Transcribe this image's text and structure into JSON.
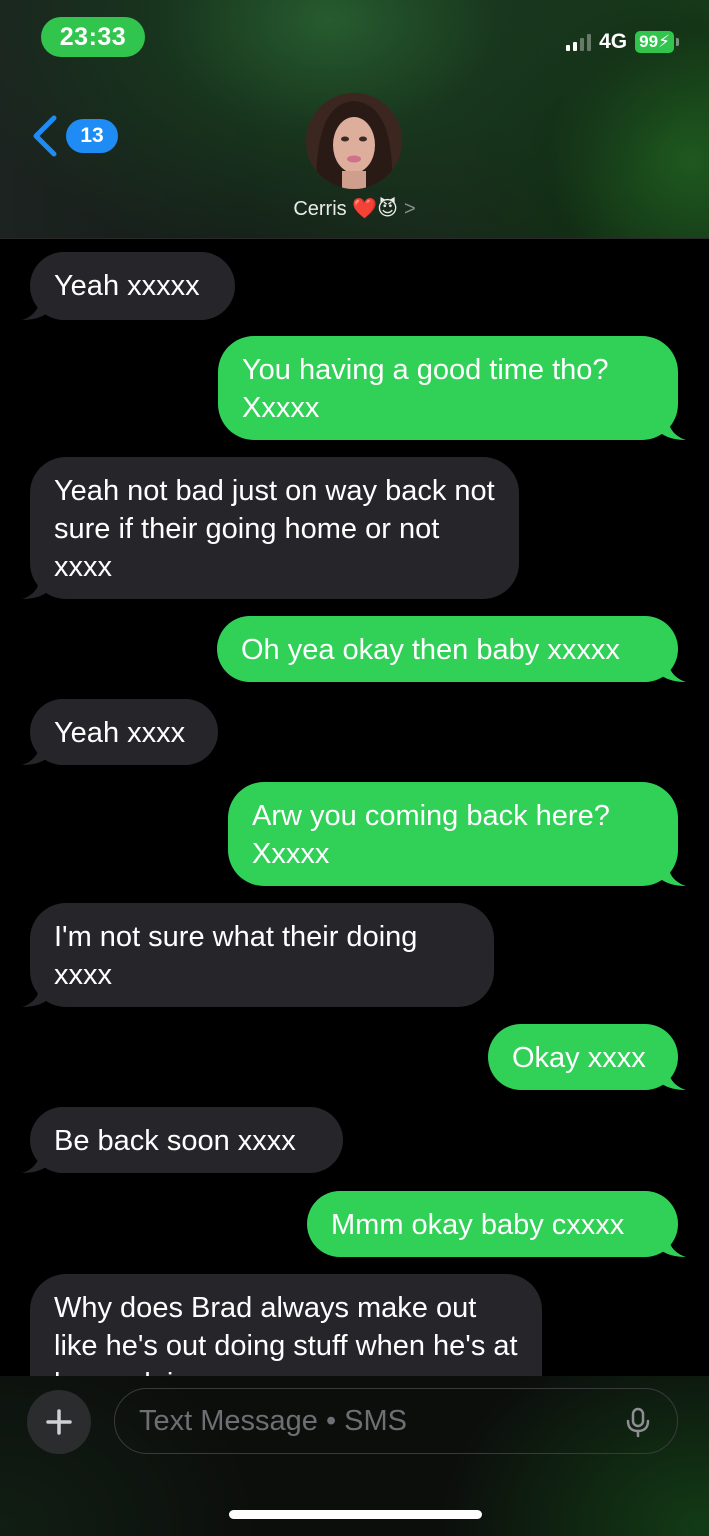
{
  "status_bar": {
    "time": "23:33",
    "network": "4G",
    "battery": "99"
  },
  "header": {
    "back_count": "13",
    "contact_name": "Cerris ❤️😈",
    "contact_chevron": ">"
  },
  "messages": [
    {
      "direction": "in",
      "text": "Yeah xxxxx"
    },
    {
      "direction": "out",
      "text": "You having a good time tho? Xxxxx"
    },
    {
      "direction": "in",
      "text": "Yeah not bad just on way back not sure if their going home or not xxxx"
    },
    {
      "direction": "out",
      "text": "Oh yea okay then baby xxxxx"
    },
    {
      "direction": "in",
      "text": "Yeah xxxx"
    },
    {
      "direction": "out",
      "text": "Arw you coming back here? Xxxxx"
    },
    {
      "direction": "in",
      "text": "I'm not sure what their doing xxxx"
    },
    {
      "direction": "out",
      "text": "Okay xxxx"
    },
    {
      "direction": "in",
      "text": "Be back soon xxxx"
    },
    {
      "direction": "out",
      "text": "Mmm okay baby cxxxx"
    },
    {
      "direction": "in",
      "text": "Why does Brad always make out like he's out doing stuff when he's at home doing"
    }
  ],
  "composer": {
    "placeholder": "Text Message • SMS"
  },
  "colors": {
    "incoming_bubble": "#26252a",
    "outgoing_bubble": "#31d158",
    "badge_blue": "#1f8bf5",
    "time_pill": "#31c54e"
  }
}
